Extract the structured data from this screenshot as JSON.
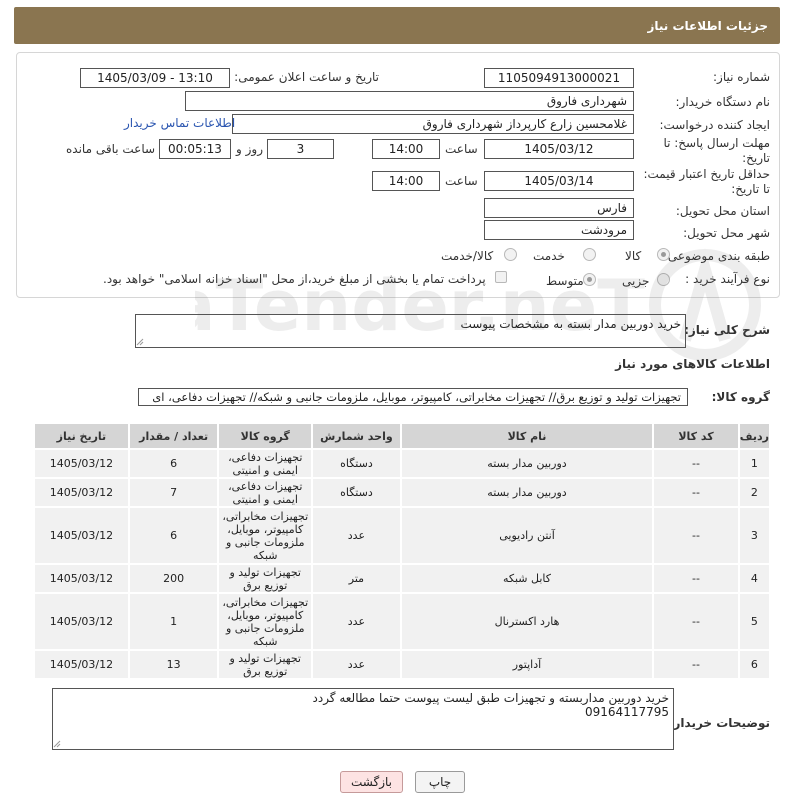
{
  "header": {
    "title": "جزئیات اطلاعات نیاز"
  },
  "form": {
    "need_number_label": "شماره نیاز:",
    "need_number": "1105094913000021",
    "announce_label": "تاریخ و ساعت اعلان عمومی:",
    "announce_value": "1405/03/09 - 13:10",
    "buyer_org_label": "نام دستگاه خریدار:",
    "buyer_org": "شهرداری فاروق",
    "creator_label": "ایجاد کننده درخواست:",
    "creator": "غلامحسین زارع کارپرداز شهرداری فاروق",
    "contact_link": "اطلاعات تماس خریدار",
    "deadline_label_1": "مهلت ارسال پاسخ: تا",
    "deadline_label_2": "تاریخ:",
    "deadline_date": "1405/03/12",
    "time_label": "ساعت",
    "deadline_time": "14:00",
    "days_value": "3",
    "days_label": "روز و",
    "remaining_time": "00:05:13",
    "remaining_label": "ساعت باقی مانده",
    "validity_label_1": "حداقل تاریخ اعتبار قیمت:",
    "validity_label_2": "تا تاریخ:",
    "validity_date": "1405/03/14",
    "validity_time": "14:00",
    "province_label": "استان محل تحویل:",
    "province": "فارس",
    "city_label": "شهر محل تحویل:",
    "city": "مرودشت",
    "category_label": "طبقه بندی موضوعی:",
    "category_options": [
      "کالا",
      "خدمت",
      "کالا/خدمت"
    ],
    "process_label": "نوع فرآیند خرید :",
    "process_options": [
      "جزیی",
      "متوسط"
    ],
    "payment_note": "پرداخت تمام یا بخشی از مبلغ خرید،از محل \"اسناد خزانه اسلامی\" خواهد بود."
  },
  "summary": {
    "label": "شرح کلی نیاز:",
    "text": "خرید دوربین مدار بسته به مشخصات پیوست"
  },
  "goods": {
    "section_title": "اطلاعات کالاهای مورد نیاز",
    "group_label": "گروه کالا:",
    "group_value": "تجهیزات تولید و توزیع برق// تجهیزات مخابراتی، کامپیوتر، موبایل، ملزومات جانبی و شبکه// تجهیزات دفاعی، ای"
  },
  "table": {
    "headers": [
      "ردیف",
      "کد کالا",
      "نام کالا",
      "واحد شمارش",
      "گروه کالا",
      "تعداد / مقدار",
      "تاریخ نیاز"
    ],
    "rows": [
      {
        "idx": "1",
        "code": "--",
        "name": "دوربین مدار بسته",
        "unit": "دستگاه",
        "group": "تجهیزات دفاعی، ایمنی و امنیتی",
        "qty": "6",
        "date": "1405/03/12"
      },
      {
        "idx": "2",
        "code": "--",
        "name": "دوربین مدار بسته",
        "unit": "دستگاه",
        "group": "تجهیزات دفاعی، ایمنی و امنیتی",
        "qty": "7",
        "date": "1405/03/12"
      },
      {
        "idx": "3",
        "code": "--",
        "name": "آنتن رادیویی",
        "unit": "عدد",
        "group": "تجهیزات مخابراتی، کامپیوتر، موبایل، ملزومات جانبی و شبکه",
        "qty": "6",
        "date": "1405/03/12"
      },
      {
        "idx": "4",
        "code": "--",
        "name": "کابل شبکه",
        "unit": "متر",
        "group": "تجهیزات تولید و توزیع برق",
        "qty": "200",
        "date": "1405/03/12"
      },
      {
        "idx": "5",
        "code": "--",
        "name": "هارد اکسترنال",
        "unit": "عدد",
        "group": "تجهیزات مخابراتی، کامپیوتر، موبایل، ملزومات جانبی و شبکه",
        "qty": "1",
        "date": "1405/03/12"
      },
      {
        "idx": "6",
        "code": "--",
        "name": "آداپتور",
        "unit": "عدد",
        "group": "تجهیزات تولید و توزیع برق",
        "qty": "13",
        "date": "1405/03/12"
      }
    ]
  },
  "buyer_notes": {
    "label": "توضیحات خریدار:",
    "line1": "خرید دوربین مداربسته و تجهیزات طبق لیست پیوست حتما مطالعه گردد",
    "line2": "09164117795"
  },
  "buttons": {
    "print": "چاپ",
    "back": "بازگشت"
  },
  "watermark": "AriaTender.neT"
}
